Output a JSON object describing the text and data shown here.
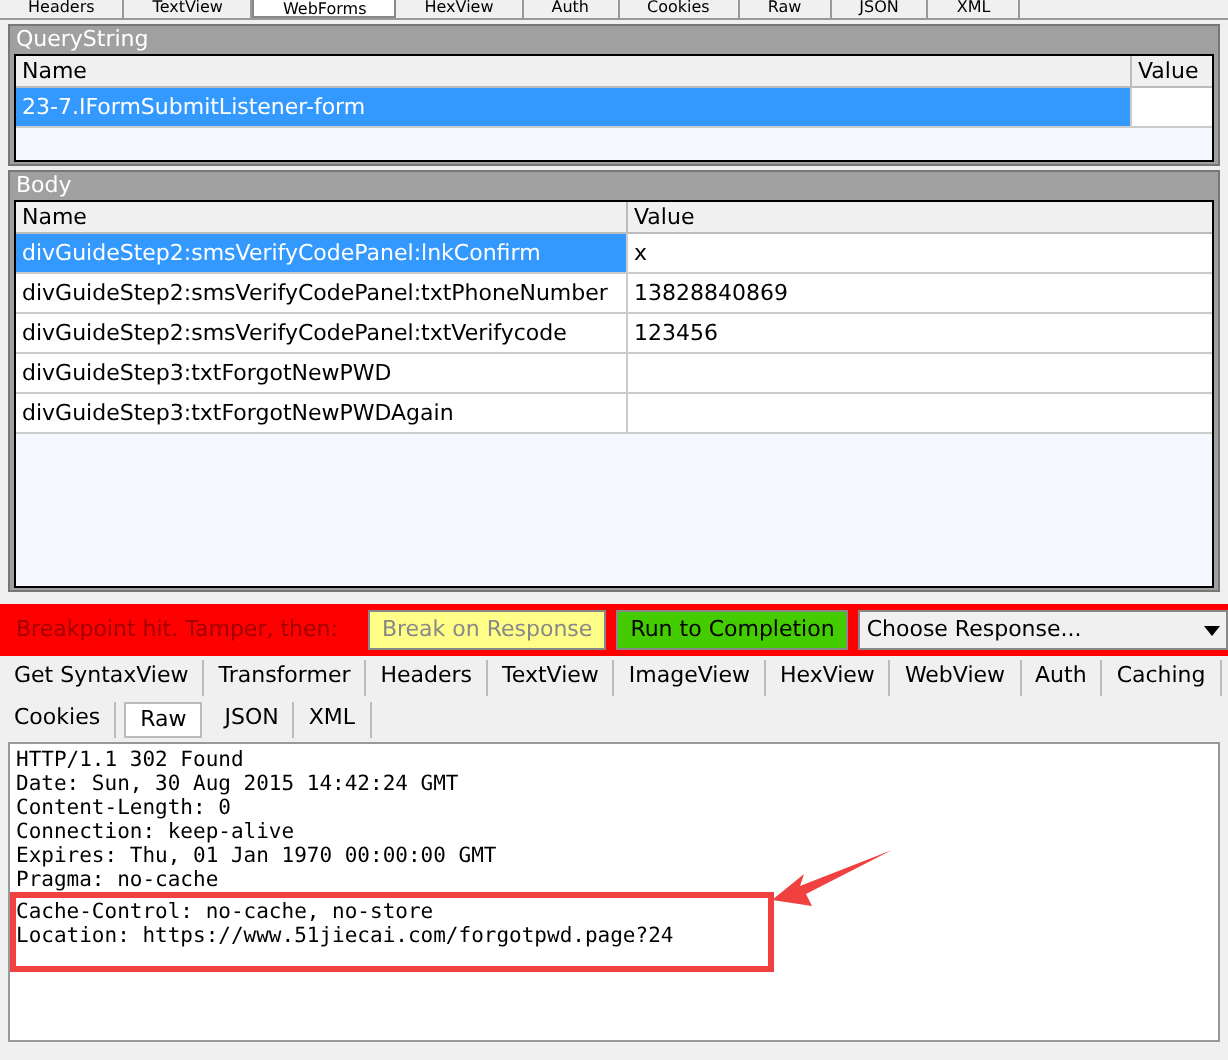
{
  "request_tabs": [
    {
      "label": "Headers",
      "selected": false
    },
    {
      "label": "TextView",
      "selected": false
    },
    {
      "label": "WebForms",
      "selected": true
    },
    {
      "label": "HexView",
      "selected": false
    },
    {
      "label": "Auth",
      "selected": false
    },
    {
      "label": "Cookies",
      "selected": false
    },
    {
      "label": "Raw",
      "selected": false
    },
    {
      "label": "JSON",
      "selected": false
    },
    {
      "label": "XML",
      "selected": false
    }
  ],
  "query_string": {
    "title": "QueryString",
    "columns": [
      "Name",
      "Value"
    ],
    "rows": [
      {
        "name": "23-7.IFormSubmitListener-form",
        "value": "",
        "selected": true
      }
    ]
  },
  "body": {
    "title": "Body",
    "columns": [
      "Name",
      "Value"
    ],
    "rows": [
      {
        "name": "divGuideStep2:smsVerifyCodePanel:lnkConfirm",
        "value": "x",
        "selected": true
      },
      {
        "name": "divGuideStep2:smsVerifyCodePanel:txtPhoneNumber",
        "value": "13828840869",
        "selected": false
      },
      {
        "name": "divGuideStep2:smsVerifyCodePanel:txtVerifycode",
        "value": "123456",
        "selected": false
      },
      {
        "name": "divGuideStep3:txtForgotNewPWD",
        "value": "",
        "selected": false
      },
      {
        "name": "divGuideStep3:txtForgotNewPWDAgain",
        "value": "",
        "selected": false
      }
    ]
  },
  "breakpoint_bar": {
    "message": "Breakpoint hit. Tamper, then:",
    "buttons": [
      {
        "label": "Break on Response",
        "disabled": true
      },
      {
        "label": "Run to Completion",
        "disabled": false
      }
    ],
    "response_select": "Choose Response..."
  },
  "response_tabs": [
    [
      {
        "label": "Get SyntaxView",
        "selected": false
      },
      {
        "label": "Transformer",
        "selected": false
      },
      {
        "label": "Headers",
        "selected": false
      },
      {
        "label": "TextView",
        "selected": false
      },
      {
        "label": "ImageView",
        "selected": false
      },
      {
        "label": "HexView",
        "selected": false
      },
      {
        "label": "WebView",
        "selected": false
      },
      {
        "label": "Auth",
        "selected": false
      },
      {
        "label": "Caching",
        "selected": false
      }
    ],
    [
      {
        "label": "Cookies",
        "selected": false
      },
      {
        "label": "Raw",
        "selected": true
      },
      {
        "label": "JSON",
        "selected": false
      },
      {
        "label": "XML",
        "selected": false
      }
    ]
  ],
  "raw_response": [
    "HTTP/1.1 302 Found",
    "Date: Sun, 30 Aug 2015 14:42:24 GMT",
    "Content-Length: 0",
    "Connection: keep-alive",
    "Expires: Thu, 01 Jan 1970 00:00:00 GMT",
    "Pragma: no-cache",
    "Cache-Control: no-cache, no-store",
    "Location: https://www.51jiecai.com/forgotpwd.page?24"
  ]
}
